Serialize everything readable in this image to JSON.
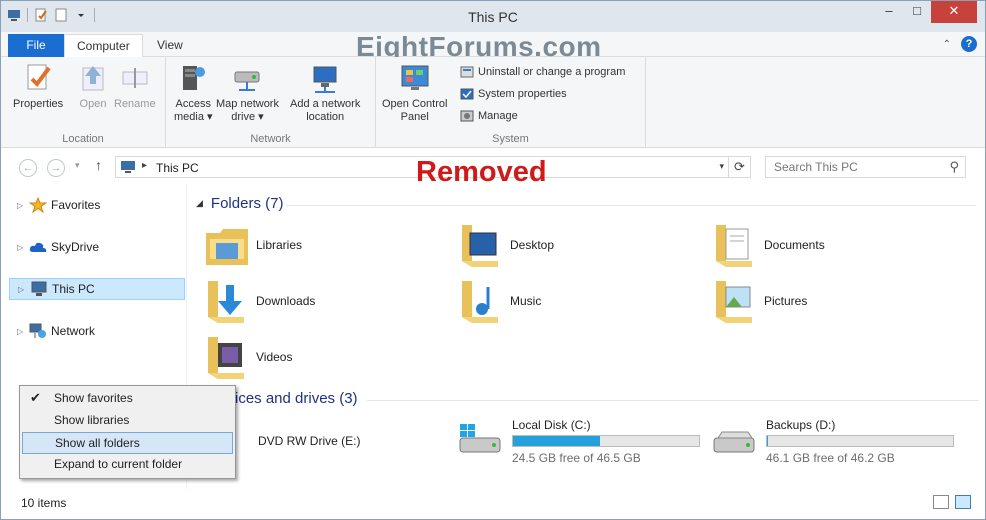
{
  "window": {
    "title": "This PC",
    "watermark": "EightForums.com",
    "overlay_text": "Removed"
  },
  "ribbon_tabs": {
    "file": "File",
    "computer": "Computer",
    "view": "View"
  },
  "ribbon": {
    "location": {
      "label": "Location",
      "properties": "Properties",
      "open": "Open",
      "rename": "Rename"
    },
    "network": {
      "label": "Network",
      "access_media_l1": "Access",
      "access_media_l2": "media ▾",
      "map_drive_l1": "Map network",
      "map_drive_l2": "drive ▾",
      "add_location_l1": "Add a network",
      "add_location_l2": "location"
    },
    "system": {
      "label": "System",
      "control_panel_l1": "Open Control",
      "control_panel_l2": "Panel",
      "uninstall": "Uninstall or change a program",
      "sys_props": "System properties",
      "manage": "Manage"
    }
  },
  "address": {
    "crumb": "This PC",
    "search_placeholder": "Search This PC"
  },
  "nav": {
    "favorites": "Favorites",
    "skydrive": "SkyDrive",
    "this_pc": "This PC",
    "network": "Network"
  },
  "content": {
    "folders_header": "Folders (7)",
    "folders": [
      "Libraries",
      "Desktop",
      "Documents",
      "Downloads",
      "Music",
      "Pictures",
      "Videos"
    ],
    "devices_header": "ices and drives (3)",
    "drives": [
      {
        "name": "DVD RW Drive (E:)"
      },
      {
        "name": "Local Disk (C:)",
        "free": "24.5 GB free of 46.5 GB",
        "used_fraction": 0.47
      },
      {
        "name": "Backups (D:)",
        "free": "46.1 GB free of 46.2 GB",
        "used_fraction": 0.002
      }
    ]
  },
  "context_menu": {
    "show_favorites": "Show favorites",
    "show_libraries": "Show libraries",
    "show_all_folders": "Show all folders",
    "expand_current": "Expand to current folder"
  },
  "status": {
    "count": "10 items"
  },
  "colors": {
    "accent": "#1a6ed1",
    "selection": "#cce8ff",
    "drive_fill": "#26a0da",
    "removed": "#d01a1a"
  }
}
